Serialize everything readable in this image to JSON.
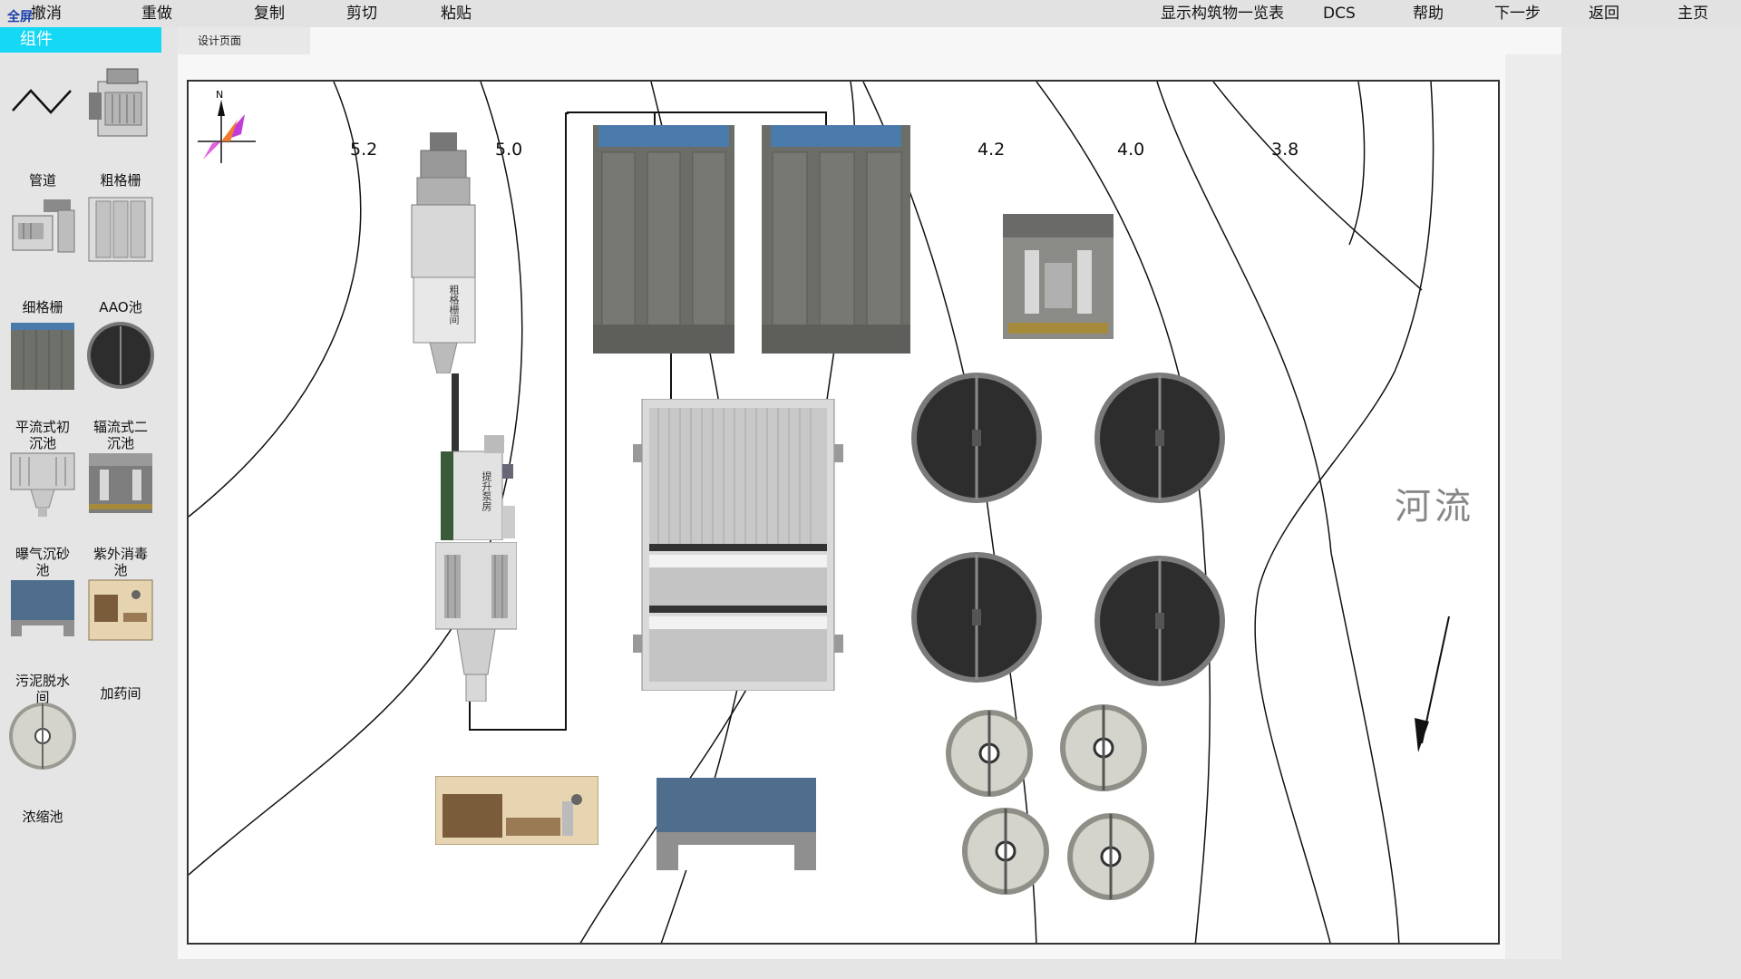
{
  "menu": {
    "undo": "撤消",
    "fullscreen": "全屏",
    "redo": "重做",
    "copy": "复制",
    "cut": "剪切",
    "paste": "粘贴",
    "show_list": "显示构筑物一览表",
    "dcs": "DCS",
    "help": "帮助",
    "next": "下一步",
    "back": "返回",
    "home": "主页"
  },
  "sidebar": {
    "header": "组件",
    "components": [
      {
        "label": "管道"
      },
      {
        "label": "粗格栅"
      },
      {
        "label": "细格栅"
      },
      {
        "label": "AAO池"
      },
      {
        "label": "平流式初\n沉池"
      },
      {
        "label": "辐流式二\n沉池"
      },
      {
        "label": "曝气沉砂\n池"
      },
      {
        "label": "紫外消毒\n池"
      },
      {
        "label": "污泥脱水\n间"
      },
      {
        "label": "加药间"
      },
      {
        "label": "浓缩池"
      }
    ]
  },
  "tabs": [
    {
      "label": "设计页面"
    }
  ],
  "canvas": {
    "contour_labels": [
      "5.2",
      "5.0",
      "4.2",
      "4.0",
      "3.8"
    ],
    "river_label": "河流",
    "compass_letter": "N",
    "grille_text": "粗格栅间",
    "pump_text": "提升泵房"
  },
  "colors": {
    "sidebar_header": "#15d8f5",
    "tank_roof": "#4a7bab",
    "dark_tank": "#2d2d2d",
    "concrete": "#8a8a8a"
  }
}
